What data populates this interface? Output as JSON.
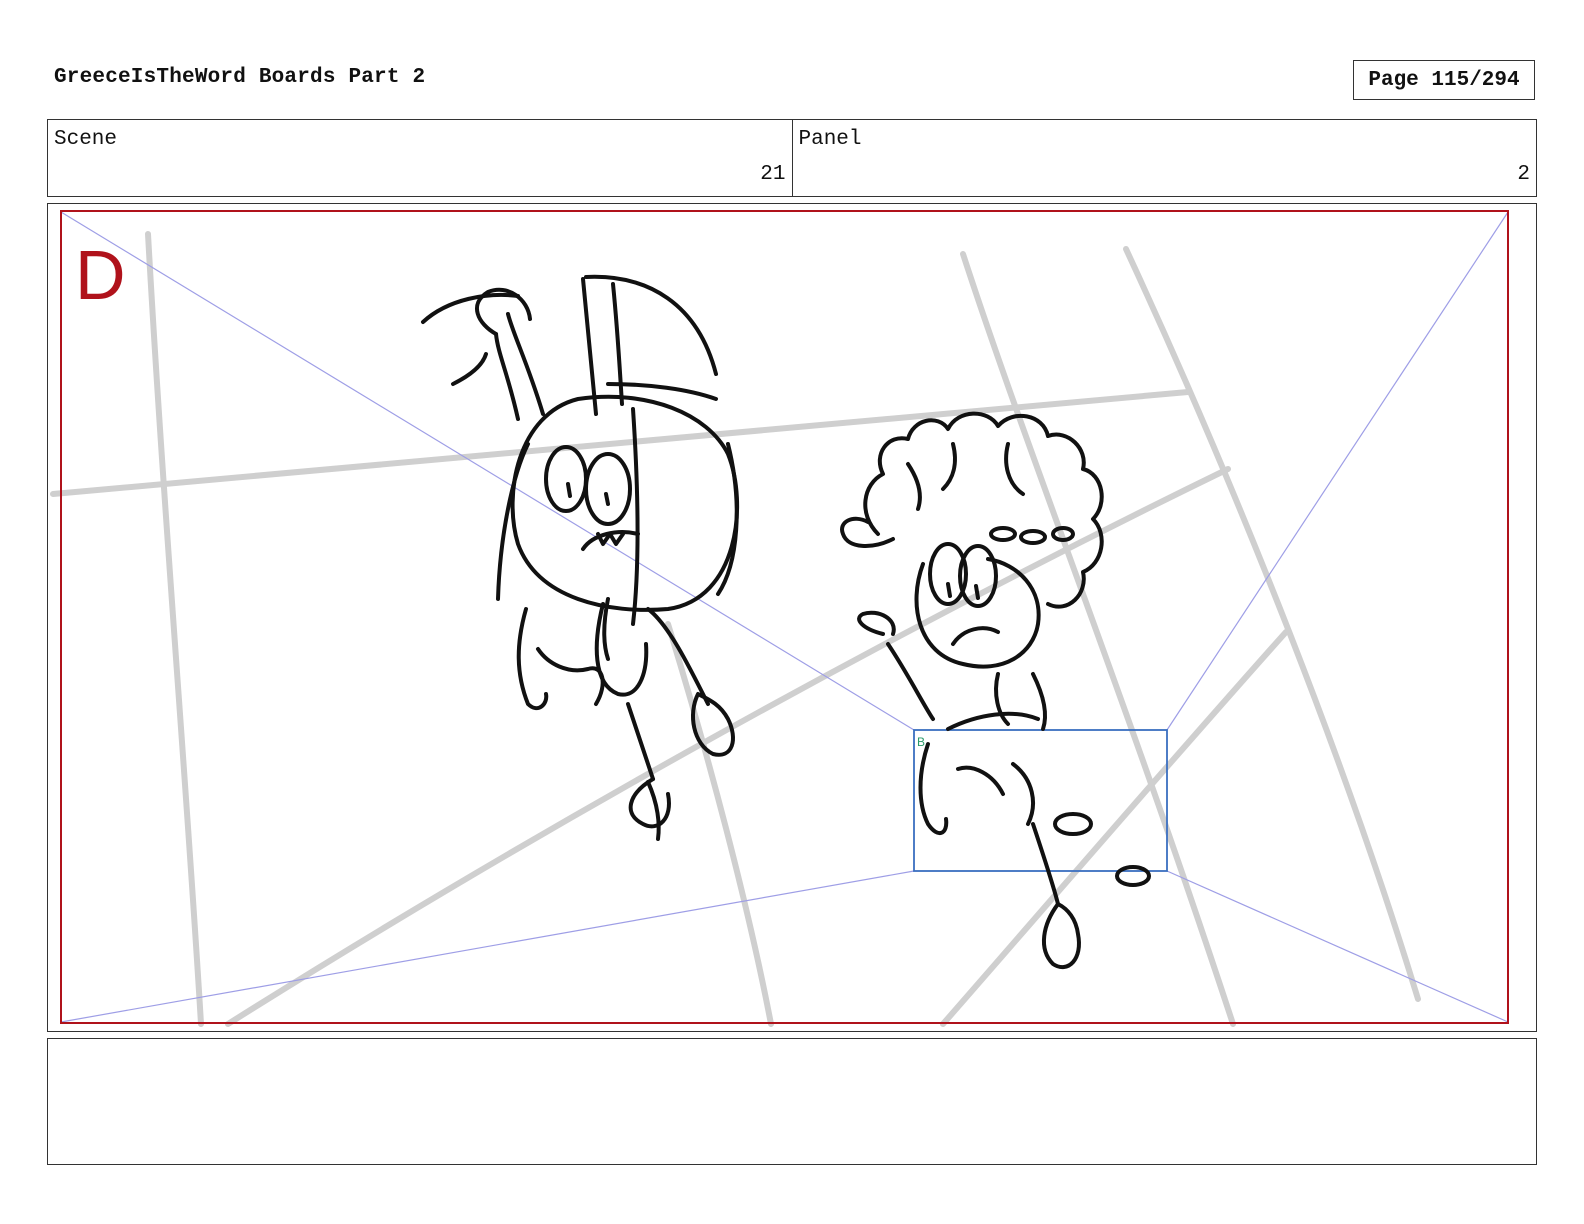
{
  "header": {
    "title": "GreeceIsTheWord Boards Part 2",
    "page_label": "Page 115/294"
  },
  "info": {
    "scene_label": "Scene",
    "scene_value": "21",
    "panel_label": "Panel",
    "panel_value": "2"
  },
  "panel": {
    "field_letter": "D",
    "camera_marker": "B",
    "colors": {
      "safe_frame": "#b0121b",
      "camera_box": "#3a6fc0",
      "perspective_lines": "#9e9ee6",
      "construction_lines": "#cfcfcf",
      "ink": "#111111"
    }
  },
  "caption": {
    "text": ""
  }
}
